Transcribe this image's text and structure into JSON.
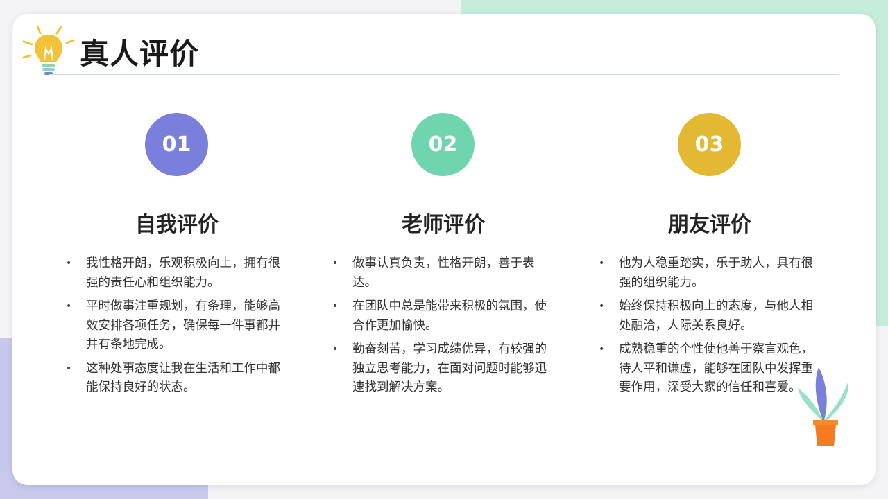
{
  "title": "真人评价",
  "colors": {
    "c1": "#7a7fdc",
    "c2": "#6ed5ae",
    "c3": "#e3b832"
  },
  "columns": [
    {
      "number": "01",
      "heading": "自我评价",
      "bullets": [
        "我性格开朗，乐观积极向上，拥有很强的责任心和组织能力。",
        "平时做事注重规划，有条理，能够高效安排各项任务，确保每一件事都井井有条地完成。",
        "这种处事态度让我在生活和工作中都能保持良好的状态。"
      ]
    },
    {
      "number": "02",
      "heading": "老师评价",
      "bullets": [
        "做事认真负责，性格开朗，善于表达。",
        "在团队中总是能带来积极的氛围，使合作更加愉快。",
        "勤奋刻苦，学习成绩优异，有较强的独立思考能力，在面对问题时能够迅速找到解决方案。"
      ]
    },
    {
      "number": "03",
      "heading": "朋友评价",
      "bullets": [
        "他为人稳重踏实，乐于助人，具有很强的组织能力。",
        "始终保持积极向上的态度，与他人相处融洽，人际关系良好。",
        "成熟稳重的个性使他善于察言观色，待人平和谦虚，能够在团队中发挥重要作用，深受大家的信任和喜爱。"
      ]
    }
  ]
}
